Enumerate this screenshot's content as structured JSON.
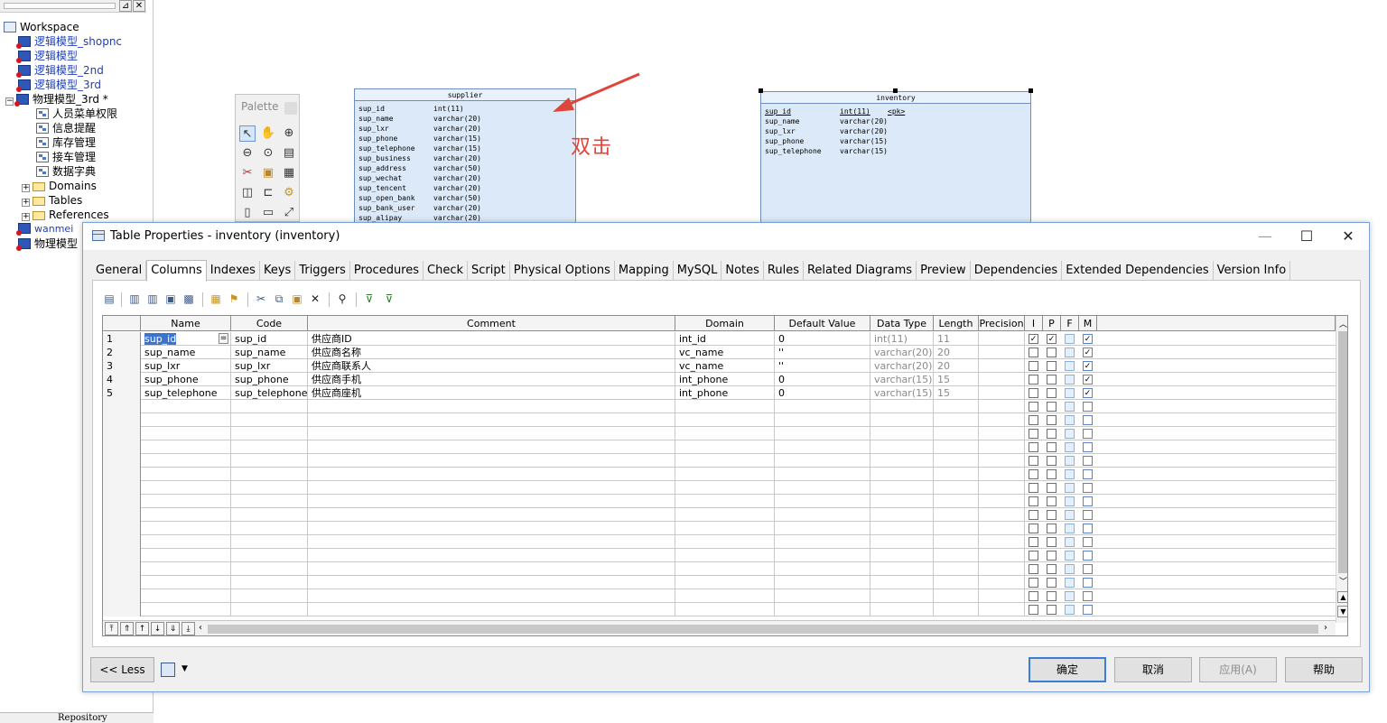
{
  "workspace": {
    "root": "Workspace",
    "items": [
      {
        "label": "逻辑模型_shopnc"
      },
      {
        "label": "逻辑模型"
      },
      {
        "label": "逻辑模型_2nd"
      },
      {
        "label": "逻辑模型_3rd"
      },
      {
        "label": "物理模型_3rd *"
      }
    ],
    "children": [
      {
        "label": "人员菜单权限"
      },
      {
        "label": "信息提醒"
      },
      {
        "label": "库存管理"
      },
      {
        "label": "接车管理"
      },
      {
        "label": "数据字典"
      }
    ],
    "folders": [
      {
        "label": "Domains"
      },
      {
        "label": "Tables"
      },
      {
        "label": "References"
      }
    ],
    "extra": [
      {
        "label": "wanmei"
      },
      {
        "label": "物理模型"
      }
    ],
    "bottom_tab": "Repository"
  },
  "palette": {
    "title": "Palette"
  },
  "canvas": {
    "annotation": "双击",
    "supplier": {
      "title": "supplier",
      "rows": [
        {
          "name": "sup_id",
          "type": "int(11)"
        },
        {
          "name": "sup_name",
          "type": "varchar(20)"
        },
        {
          "name": "sup_lxr",
          "type": "varchar(20)"
        },
        {
          "name": "sup_phone",
          "type": "varchar(15)"
        },
        {
          "name": "sup_telephone",
          "type": "varchar(15)"
        },
        {
          "name": "sup_business",
          "type": "varchar(20)"
        },
        {
          "name": "sup_address",
          "type": "varchar(50)"
        },
        {
          "name": "sup_wechat",
          "type": "varchar(20)"
        },
        {
          "name": "sup_tencent",
          "type": "varchar(20)"
        },
        {
          "name": "sup_open_bank",
          "type": "varchar(50)"
        },
        {
          "name": "sup_bank_user",
          "type": "varchar(20)"
        },
        {
          "name": "sup_alipay",
          "type": "varchar(20)"
        }
      ]
    },
    "inventory": {
      "title": "inventory",
      "rows": [
        {
          "name": "sup_id",
          "type": "int(11)",
          "key": "<pk>"
        },
        {
          "name": "sup_name",
          "type": "varchar(20)",
          "key": ""
        },
        {
          "name": "sup_lxr",
          "type": "varchar(20)",
          "key": ""
        },
        {
          "name": "sup_phone",
          "type": "varchar(15)",
          "key": ""
        },
        {
          "name": "sup_telephone",
          "type": "varchar(15)",
          "key": ""
        }
      ]
    }
  },
  "dialog": {
    "title": "Table Properties - inventory (inventory)",
    "window_buttons": {
      "minimize": "—",
      "maximize": "☐",
      "close": "✕"
    },
    "tabs": [
      {
        "label": "General"
      },
      {
        "label": "Columns"
      },
      {
        "label": "Indexes"
      },
      {
        "label": "Keys"
      },
      {
        "label": "Triggers"
      },
      {
        "label": "Procedures"
      },
      {
        "label": "Check"
      },
      {
        "label": "Script"
      },
      {
        "label": "Physical Options"
      },
      {
        "label": "Mapping"
      },
      {
        "label": "MySQL"
      },
      {
        "label": "Notes"
      },
      {
        "label": "Rules"
      },
      {
        "label": "Related Diagrams"
      },
      {
        "label": "Preview"
      },
      {
        "label": "Dependencies"
      },
      {
        "label": "Extended Dependencies"
      },
      {
        "label": "Version Info"
      }
    ],
    "active_tab": "Columns",
    "grid": {
      "headers": {
        "name": "Name",
        "code": "Code",
        "comment": "Comment",
        "domain": "Domain",
        "default": "Default Value",
        "datatype": "Data Type",
        "length": "Length",
        "precision": "Precision",
        "i": "I",
        "p": "P",
        "f": "F",
        "m": "M"
      },
      "rows": [
        {
          "num": "1",
          "name": "sup_id",
          "code": "sup_id",
          "comment": "供应商ID",
          "domain": "int_id",
          "default": "0",
          "datatype": "int(11)",
          "length": "11",
          "precision": "",
          "i": true,
          "p": true,
          "f": false,
          "m": true
        },
        {
          "num": "2",
          "name": "sup_name",
          "code": "sup_name",
          "comment": "供应商名称",
          "domain": "vc_name",
          "default": "''",
          "datatype": "varchar(20)",
          "length": "20",
          "precision": "",
          "i": false,
          "p": false,
          "f": false,
          "m": true
        },
        {
          "num": "3",
          "name": "sup_lxr",
          "code": "sup_lxr",
          "comment": "供应商联系人",
          "domain": "vc_name",
          "default": "''",
          "datatype": "varchar(20)",
          "length": "20",
          "precision": "",
          "i": false,
          "p": false,
          "f": false,
          "m": true
        },
        {
          "num": "4",
          "name": "sup_phone",
          "code": "sup_phone",
          "comment": "供应商手机",
          "domain": "int_phone",
          "default": "0",
          "datatype": "varchar(15)",
          "length": "15",
          "precision": "",
          "i": false,
          "p": false,
          "f": false,
          "m": true
        },
        {
          "num": "5",
          "name": "sup_telephone",
          "code": "sup_telephone",
          "comment": "供应商座机",
          "domain": "int_phone",
          "default": "0",
          "datatype": "varchar(15)",
          "length": "15",
          "precision": "",
          "i": false,
          "p": false,
          "f": false,
          "m": true
        }
      ],
      "selected_cell_marker": "="
    },
    "buttons": {
      "less": "<< Less",
      "ok": "确定",
      "cancel": "取消",
      "apply": "应用(A)",
      "help": "帮助"
    }
  }
}
